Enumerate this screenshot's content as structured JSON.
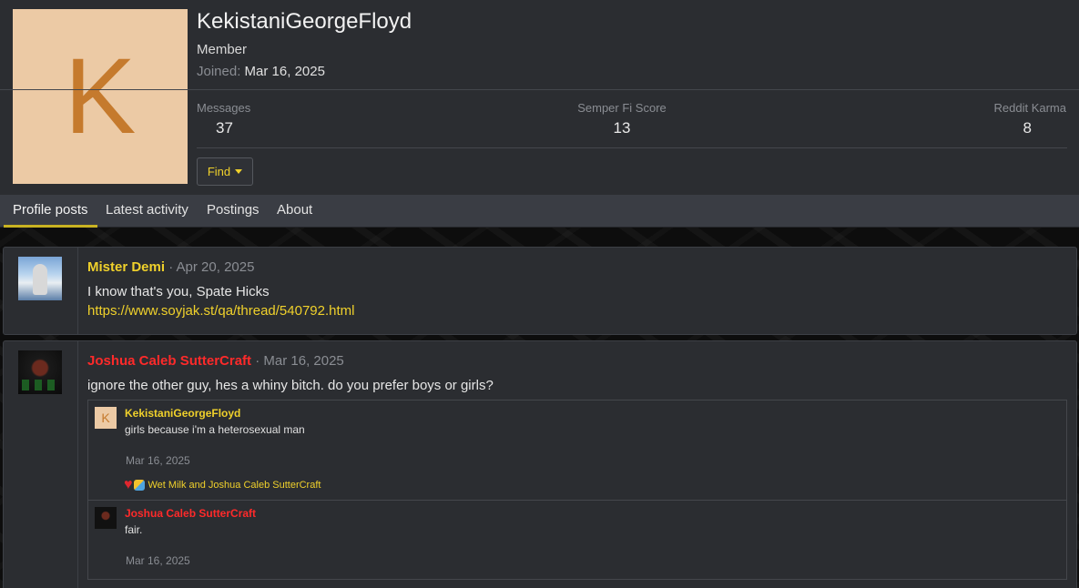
{
  "profile": {
    "avatar_letter": "K",
    "avatar_bg": "#eccaa5",
    "username": "KekistaniGeorgeFloyd",
    "user_title": "Member",
    "joined_label": "Joined:",
    "joined_date": "Mar 16, 2025",
    "stats": [
      {
        "label": "Messages",
        "value": "37"
      },
      {
        "label": "Semper Fi Score",
        "value": "13"
      },
      {
        "label": "Reddit Karma",
        "value": "8"
      }
    ],
    "find_label": "Find"
  },
  "tabs": [
    {
      "label": "Profile posts",
      "active": true
    },
    {
      "label": "Latest activity",
      "active": false
    },
    {
      "label": "Postings",
      "active": false
    },
    {
      "label": "About",
      "active": false
    }
  ],
  "posts": [
    {
      "author": "Mister Demi",
      "author_color": "#f0d12b",
      "meta": "· Apr 20, 2025",
      "body": "I know that's you, Spate Hicks",
      "link": "https://www.soyjak.st/qa/thread/540792.html"
    },
    {
      "author": "Joshua Caleb SutterCraft",
      "author_color": "#ff2a2a",
      "meta": "· Mar 16, 2025",
      "body": "ignore the other guy, hes a whiny bitch. do you prefer boys or girls?",
      "replies": [
        {
          "avatar_letter": "K",
          "author": "KekistaniGeorgeFloyd",
          "text": "girls because i'm a heterosexual man",
          "date": "Mar 16, 2025",
          "reactions": "Wet Milk and Joshua Caleb SutterCraft"
        },
        {
          "author": "Joshua Caleb SutterCraft",
          "text": "fair.",
          "date": "Mar 16, 2025"
        }
      ]
    }
  ],
  "colors": {
    "accent": "#f0d12b",
    "danger_name": "#ff2a2a",
    "panel": "#2b2d31",
    "tab_bar": "#3a3d44"
  }
}
